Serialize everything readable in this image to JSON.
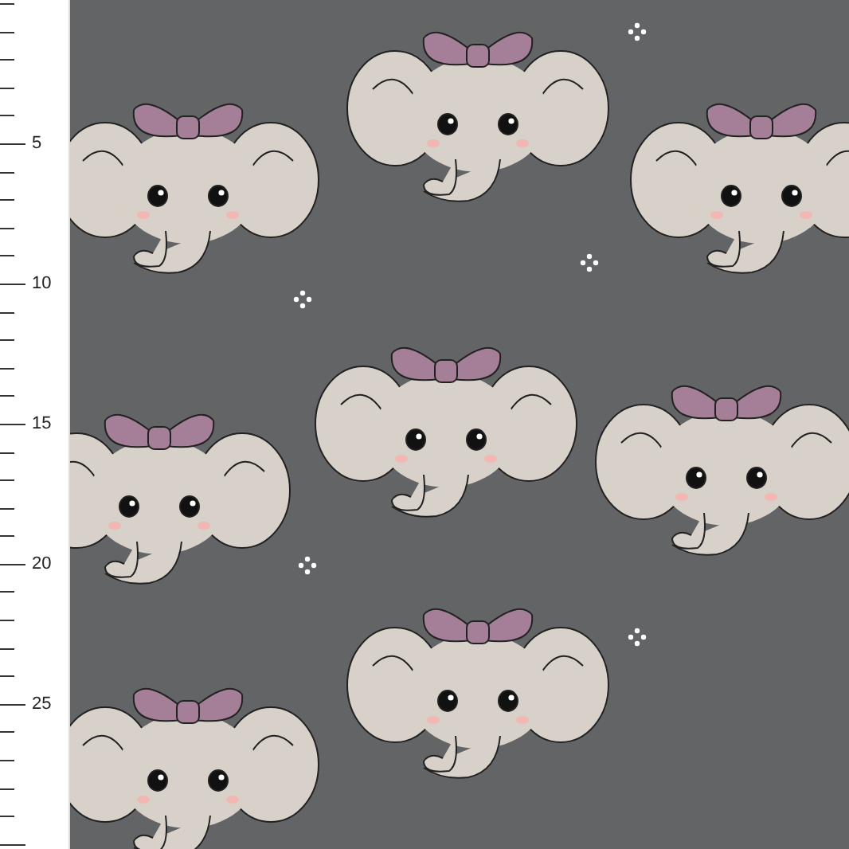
{
  "ruler": {
    "labels": [
      "5",
      "10",
      "15",
      "20",
      "25"
    ]
  }
}
